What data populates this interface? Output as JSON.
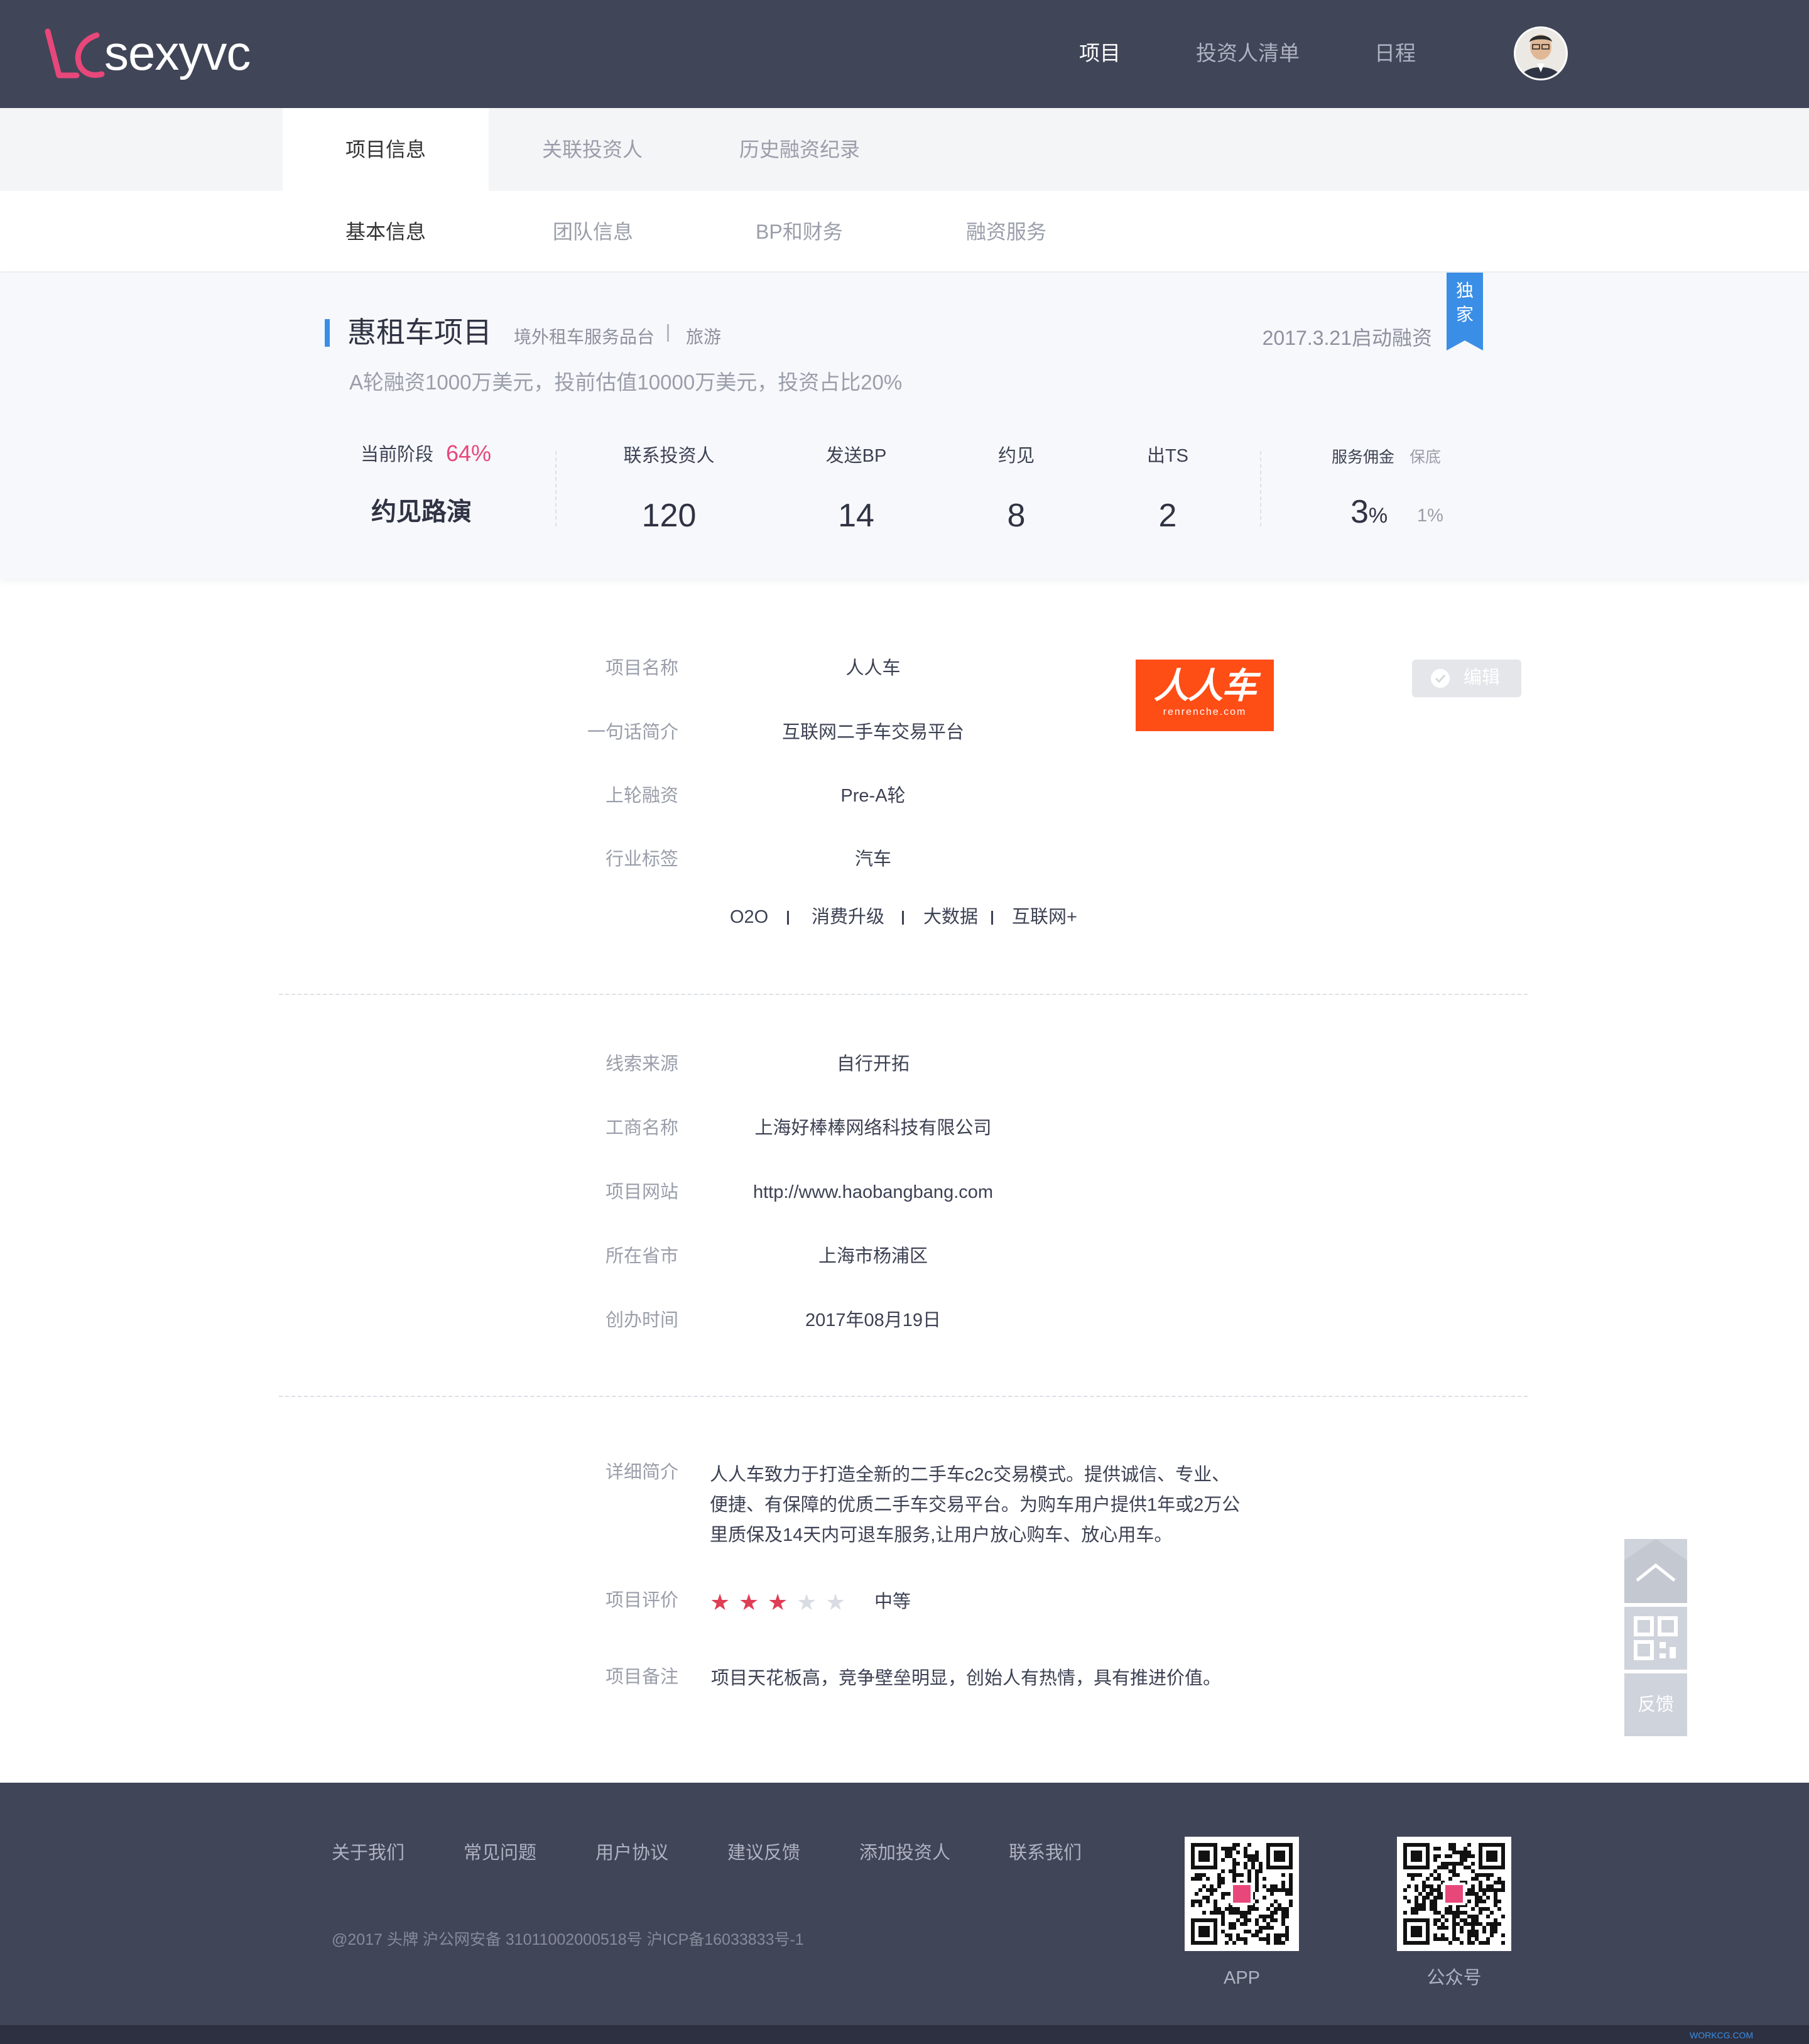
{
  "header": {
    "logo_text": "sexyvc",
    "nav": [
      "项目",
      "投资人清单",
      "日程"
    ],
    "active_nav": "项目"
  },
  "tabs_primary": [
    "项目信息",
    "关联投资人",
    "历史融资纪录"
  ],
  "tabs_secondary": [
    "基本信息",
    "团队信息",
    "BP和财务",
    "融资服务"
  ],
  "summary": {
    "title": "惠租车项目",
    "tag1": "境外租车服务品台",
    "tag2": "旅游",
    "start_date": "2017.3.21启动融资",
    "ribbon": "独家",
    "description": "A轮融资1000万美元，投前估值10000万美元，投资占比20%",
    "stage_label": "当前阶段",
    "stage_progress": "64%",
    "stage_value": "约见路演",
    "stats": [
      {
        "label": "联系投资人",
        "value": "120"
      },
      {
        "label": "发送BP",
        "value": "14"
      },
      {
        "label": "约见",
        "value": "8"
      },
      {
        "label": "出TS",
        "value": "2"
      }
    ],
    "commission_label": "服务佣金",
    "commission_sub_label": "保底",
    "commission_value": "3",
    "commission_unit": "%",
    "commission_min": "1%"
  },
  "basic": {
    "fields": [
      {
        "label": "项目名称",
        "value": "人人车"
      },
      {
        "label": "一句话简介",
        "value": "互联网二手车交易平台"
      },
      {
        "label": "上轮融资",
        "value": "Pre-A轮"
      },
      {
        "label": "行业标签",
        "value": "汽车"
      }
    ],
    "tags": [
      "O2O",
      "消费升级",
      "大数据",
      "互联网+"
    ],
    "brand_name": "人人车",
    "brand_url": "renrenche.com",
    "edit_label": "编辑"
  },
  "company": {
    "fields": [
      {
        "label": "线索来源",
        "value": "自行开拓"
      },
      {
        "label": "工商名称",
        "value": "上海好棒棒网络科技有限公司"
      },
      {
        "label": "项目网站",
        "value": "http://www.haobangbang.com"
      },
      {
        "label": "所在省市",
        "value": "上海市杨浦区"
      },
      {
        "label": "创办时间",
        "value": "2017年08月19日"
      }
    ]
  },
  "details": {
    "intro_label": "详细简介",
    "intro_lines": [
      "人人车致力于打造全新的二手车c2c交易模式。提供诚信、专业、",
      "便捷、有保障的优质二手车交易平台。为购车用户提供1年或2万公",
      "里质保及14天内可退车服务,让用户放心购车、放心用车。"
    ],
    "rating_label": "项目评价",
    "rating_stars": 3,
    "rating_max": 5,
    "rating_text": "中等",
    "note_label": "项目备注",
    "note_text": "项目天花板高，竞争壁垒明显，创始人有热情，具有推进价值。"
  },
  "side_tools": {
    "feedback": "反馈"
  },
  "footer": {
    "links": [
      "关于我们",
      "常见问题",
      "用户协议",
      "建议反馈",
      "添加投资人",
      "联系我们"
    ],
    "copyright": "@2017 头牌  沪公网安备 31011002000518号 沪ICP备16033833号-1",
    "qr_labels": [
      "APP",
      "公众号"
    ],
    "credit": "WORKCG.COM"
  },
  "colors": {
    "header_bg": "#414558",
    "accent_blue": "#3a8ee6",
    "accent_pink": "#e8477a",
    "brand_orange": "#ff4d16",
    "star_on": "#e03e55"
  }
}
